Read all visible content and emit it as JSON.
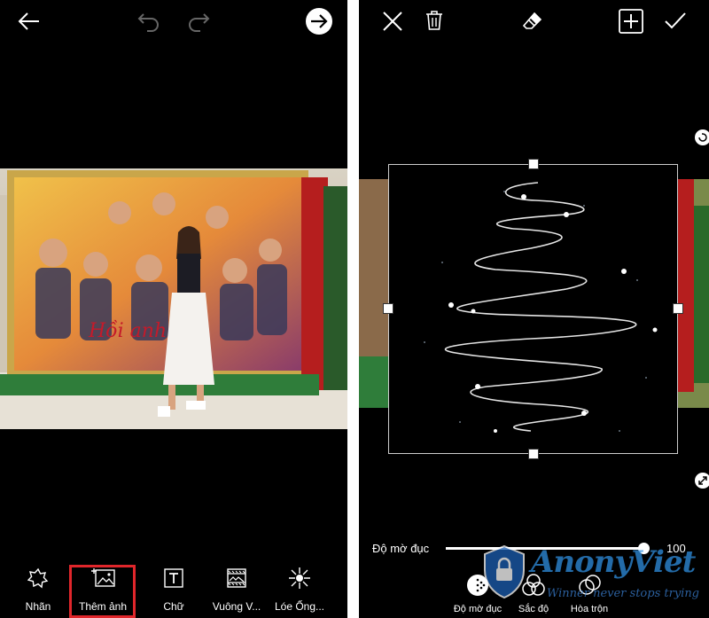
{
  "left_screen": {
    "poster_title": "Hồi anh",
    "poster_title_tail": "m",
    "tools": [
      {
        "label": "Nhãn",
        "icon": "sticker-icon"
      },
      {
        "label": "Thêm ảnh",
        "icon": "add-photo-icon"
      },
      {
        "label": "Chữ",
        "icon": "text-icon"
      },
      {
        "label": "Vuông V...",
        "icon": "square-fit-icon"
      },
      {
        "label": "Lóe Ống...",
        "icon": "lens-flare-icon"
      }
    ]
  },
  "right_screen": {
    "opacity_label": "Độ mờ đục",
    "opacity_value": "100",
    "opacity_level": 1.0,
    "tools": [
      {
        "label": "Độ mờ đục",
        "icon": "opacity-icon"
      },
      {
        "label": "Sắc độ",
        "icon": "hue-icon"
      },
      {
        "label": "Hòa trộn",
        "icon": "blend-icon"
      }
    ]
  },
  "watermark": {
    "brand": "AnonyViet",
    "tagline": "Winner never stops trying"
  },
  "colors": {
    "highlight": "#e0262b",
    "background": "#000000",
    "poster_green": "#2f7d3a"
  }
}
